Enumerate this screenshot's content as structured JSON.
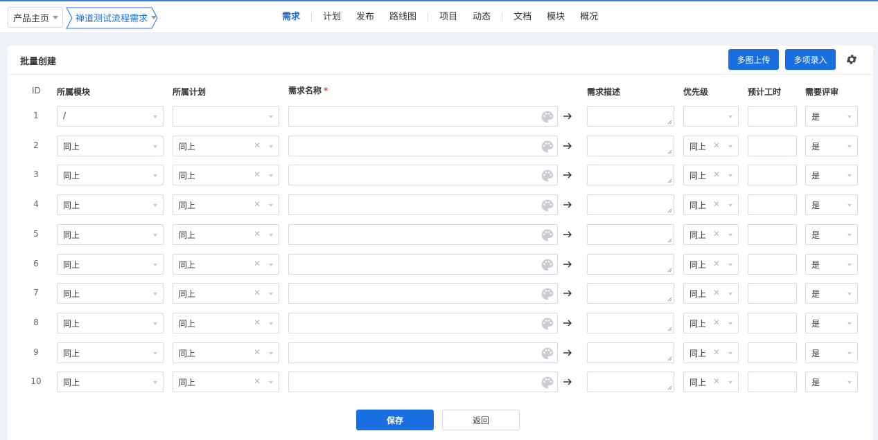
{
  "breadcrumb": {
    "home": "产品主页",
    "product": "禅道测试流程需求"
  },
  "nav": {
    "tabs": [
      "需求",
      "计划",
      "发布",
      "路线图",
      "项目",
      "动态",
      "文档",
      "模块",
      "概况"
    ],
    "active_index": 0
  },
  "panel": {
    "title": "批量创建",
    "multi_image_upload": "多图上传",
    "multi_entry": "多项录入"
  },
  "columns": {
    "id": "ID",
    "module": "所属模块",
    "plan": "所属计划",
    "name": "需求名称",
    "required_mark": "*",
    "desc": "需求描述",
    "priority": "优先级",
    "estimate": "预计工时",
    "review": "需要评审"
  },
  "rows": [
    {
      "id": "1",
      "module": "/",
      "plan": "",
      "priority": "",
      "review": "是"
    },
    {
      "id": "2",
      "module": "同上",
      "plan": "同上",
      "priority": "同上",
      "review": "是"
    },
    {
      "id": "3",
      "module": "同上",
      "plan": "同上",
      "priority": "同上",
      "review": "是"
    },
    {
      "id": "4",
      "module": "同上",
      "plan": "同上",
      "priority": "同上",
      "review": "是"
    },
    {
      "id": "5",
      "module": "同上",
      "plan": "同上",
      "priority": "同上",
      "review": "是"
    },
    {
      "id": "6",
      "module": "同上",
      "plan": "同上",
      "priority": "同上",
      "review": "是"
    },
    {
      "id": "7",
      "module": "同上",
      "plan": "同上",
      "priority": "同上",
      "review": "是"
    },
    {
      "id": "8",
      "module": "同上",
      "plan": "同上",
      "priority": "同上",
      "review": "是"
    },
    {
      "id": "9",
      "module": "同上",
      "plan": "同上",
      "priority": "同上",
      "review": "是"
    },
    {
      "id": "10",
      "module": "同上",
      "plan": "同上",
      "priority": "同上",
      "review": "是"
    }
  ],
  "footer": {
    "save": "保存",
    "back": "返回"
  },
  "colors": {
    "accent": "#1a6fe0",
    "required": "#e0403a"
  },
  "icons": [
    "caret-down-icon",
    "gear-icon",
    "palette-icon",
    "arrow-right-icon",
    "clear-x-icon",
    "resize-handle-icon"
  ]
}
